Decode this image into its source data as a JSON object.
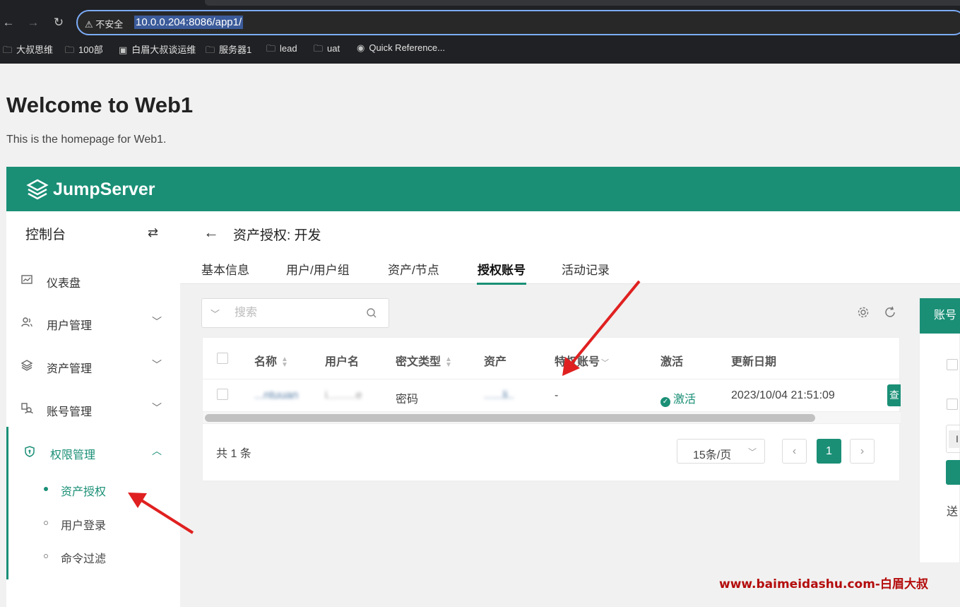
{
  "browser": {
    "security_label": "不安全",
    "url": "10.0.0.204:8086/app1/",
    "bookmarks": [
      "大叔思维",
      "100部",
      "白眉大叔谈运维",
      "服务器1",
      "lead",
      "uat",
      "Quick Reference..."
    ]
  },
  "page": {
    "heading": "Welcome to Web1",
    "subtext": "This is the homepage for Web1."
  },
  "app": {
    "logo_text": "JumpServer",
    "brand_color": "#1a8f76"
  },
  "sidebar": {
    "title": "控制台",
    "items": [
      {
        "label": "仪表盘",
        "icon": "dashboard-icon"
      },
      {
        "label": "用户管理",
        "icon": "users-icon"
      },
      {
        "label": "资产管理",
        "icon": "layers-icon"
      },
      {
        "label": "账号管理",
        "icon": "account-icon"
      },
      {
        "label": "权限管理",
        "icon": "shield-icon"
      }
    ],
    "sub_items": [
      "资产授权",
      "用户登录",
      "命令过滤"
    ]
  },
  "main": {
    "title": "资产授权: 开发",
    "tabs": [
      "基本信息",
      "用户/用户组",
      "资产/节点",
      "授权账号",
      "活动记录"
    ],
    "active_tab": "授权账号",
    "search_placeholder": "搜索"
  },
  "table": {
    "columns": [
      "名称",
      "用户名",
      "密文类型",
      "资产",
      "特权账号",
      "激活",
      "更新日期"
    ],
    "rows": [
      {
        "name": "...ntuuan",
        "username": "i.........e",
        "secret_type": "密码",
        "asset": "......li..",
        "privileged": "-",
        "active": "激活",
        "updated": "2023/10/04 21:51:09",
        "action": "查"
      }
    ],
    "total": "共 1 条",
    "page_size": "15条/页",
    "current_page": "1"
  },
  "side_card": {
    "header": "账号",
    "input_value": "I",
    "text": "送"
  },
  "watermark": "www.baimeidashu.com-白眉大叔"
}
